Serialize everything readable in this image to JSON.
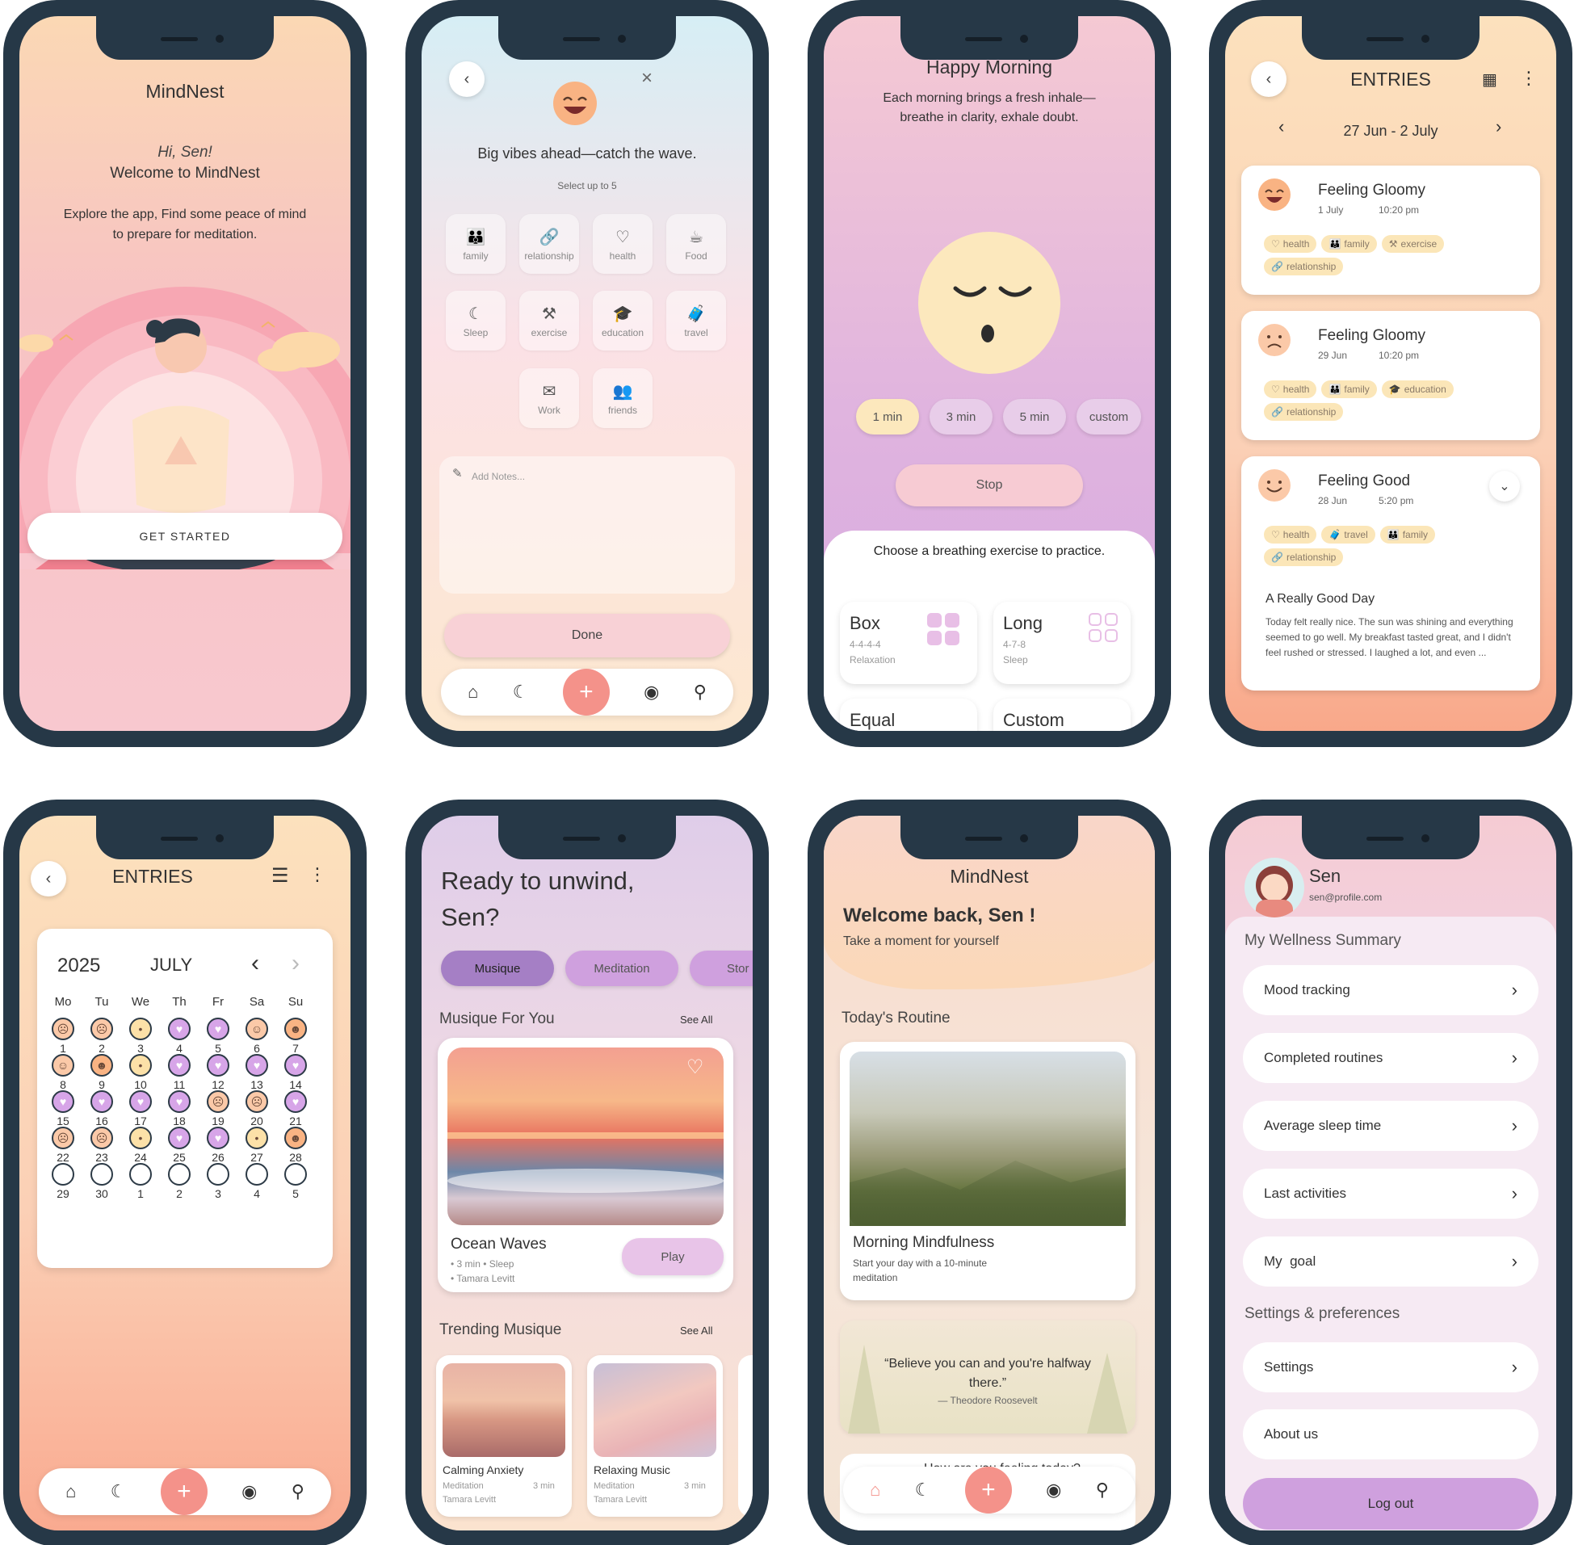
{
  "s1": {
    "title": "MindNest",
    "greet": "Hi, Sen!",
    "welcome": "Welcome to MindNest",
    "desc": "Explore the app, Find some peace of mind to prepare for meditation.",
    "btn": "GET STARTED"
  },
  "s2": {
    "heading": "Big vibes ahead—catch the wave.",
    "sub": "Select up to 5",
    "tiles": [
      "family",
      "relationship",
      "health",
      "Food",
      "Sleep",
      "exercise",
      "education",
      "travel",
      "Work",
      "friends"
    ],
    "notes": "Add Notes...",
    "done": "Done"
  },
  "s3": {
    "title": "Happy Morning",
    "desc": "Each morning brings a fresh inhale—breathe in clarity, exhale doubt.",
    "durations": [
      "1 min",
      "3 min",
      "5 min",
      "custom"
    ],
    "stop": "Stop",
    "choose": "Choose a breathing exercise to practice.",
    "ex": [
      {
        "name": "Box",
        "pattern": "4-4-4-4",
        "tag": "Relaxation"
      },
      {
        "name": "Long",
        "pattern": "4-7-8",
        "tag": "Sleep"
      },
      {
        "name": "Equal"
      },
      {
        "name": "Custom"
      }
    ]
  },
  "s4": {
    "title": "ENTRIES",
    "range": "27 Jun - 2 July",
    "entries": [
      {
        "mood": "Feeling Gloomy",
        "date": "1 July",
        "time": "10:20 pm",
        "tags": [
          "health",
          "family",
          "exercise",
          "relationship"
        ]
      },
      {
        "mood": "Feeling Gloomy",
        "date": "29 Jun",
        "time": "10:20 pm",
        "tags": [
          "health",
          "family",
          "education",
          "relationship"
        ]
      },
      {
        "mood": "Feeling Good",
        "date": "28 Jun",
        "time": "5:20 pm",
        "tags": [
          "health",
          "travel",
          "family",
          "relationship"
        ],
        "note_title": "A Really Good Day",
        "note": "Today felt really nice. The sun was shining and everything seemed to go well. My breakfast tasted great, and I didn't feel rushed or stressed. I laughed a lot, and even ..."
      }
    ]
  },
  "s5": {
    "title": "ENTRIES",
    "year": "2025",
    "month": "JULY",
    "days": [
      "Mo",
      "Tu",
      "We",
      "Th",
      "Fr",
      "Sa",
      "Su"
    ],
    "dates": [
      "1",
      "2",
      "3",
      "4",
      "5",
      "6",
      "7",
      "8",
      "9",
      "10",
      "11",
      "12",
      "13",
      "14",
      "15",
      "16",
      "17",
      "18",
      "19",
      "20",
      "21",
      "22",
      "23",
      "24",
      "25",
      "26",
      "27",
      "28",
      "29",
      "30",
      "1",
      "2",
      "3",
      "4",
      "5"
    ]
  },
  "s6": {
    "heading1": "Ready to unwind,",
    "heading2": "Sen?",
    "tabs": [
      "Musique",
      "Meditation",
      "Stor"
    ],
    "sec1": "Musique For You",
    "seeall": "See All",
    "card": {
      "title": "Ocean Waves",
      "dur": "3 min",
      "tag": "Sleep",
      "author": "Tamara Levitt",
      "play": "Play"
    },
    "sec2": "Trending Musique",
    "trend": [
      {
        "title": "Calming Anxiety",
        "tag": "Meditation",
        "dur": "3 min",
        "author": "Tamara Levitt"
      },
      {
        "title": "Relaxing Music",
        "tag": "Meditation",
        "dur": "3 min",
        "author": "Tamara Levitt"
      }
    ]
  },
  "s7": {
    "title": "MindNest",
    "welcome": "Welcome back, Sen !",
    "sub": "Take a moment for yourself",
    "routine": "Today's Routine",
    "card_title": "Morning Mindfulness",
    "card_desc": "Start your day with a 10-minute meditation",
    "quote": "“Believe you can and you're halfway there.”",
    "quote_author": "— Theodore Roosevelt",
    "feeling": "How are you feeling today?"
  },
  "s8": {
    "name": "Sen",
    "email": "sen@profile.com",
    "summary": "My Wellness Summary",
    "items": [
      "Mood tracking",
      "Completed routines",
      "Average sleep time",
      "Last activities",
      "My  goal"
    ],
    "settings_title": "Settings & preferences",
    "settings": [
      "Settings",
      "About us"
    ],
    "logout": "Log out"
  },
  "colors": {
    "peach": "#fbd8b4",
    "pink": "#f6c5cd",
    "lavender": "#cfa7e0",
    "coral": "#f4928a",
    "navy": "#263847"
  }
}
